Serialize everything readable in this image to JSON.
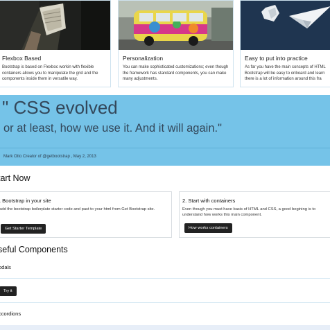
{
  "cards": [
    {
      "title": "Flexbox Based",
      "text": "Bootstrap is based on Flexboc workin with flexible containers allows you to manipulate the grid and the components inside them in versatile way."
    },
    {
      "title": "Personalization",
      "text": "You can make sophisticated customizations; even though the framework has standard components, you can make many adjustments."
    },
    {
      "title": "Easy to put into practice",
      "text": "As far you have the main concepts of HTML Bootstrap will be easy to onboard and learn there is a lot of information around this fra"
    }
  ],
  "quote": {
    "line1": "\" CSS evolved",
    "line2": "or at least, how we use it. And it will again.\"",
    "attribution": "Mark Otto Creator of @getbootstrap , May 2, 2013"
  },
  "start": {
    "title": "tart Now",
    "steps": [
      {
        "title": ". Bootstrap in your site",
        "text": "add the bootstrap boilerplate starter code and past to your html from Get Bootstrap site.",
        "button": "Get Starter Template"
      },
      {
        "title": "2. Start with containers",
        "text": "Even though you must have basis of HTML and CSS, a good begining is to understand how works this main component.",
        "button": "How works containers"
      }
    ]
  },
  "components": {
    "title": "seful Components",
    "modals_label": "odals",
    "try_button": "Try it",
    "accordions_label": "ccordions"
  },
  "colors": {
    "quote_bg": "#75c3e8",
    "button_bg": "#222222",
    "card_border": "#cfe3ef"
  }
}
